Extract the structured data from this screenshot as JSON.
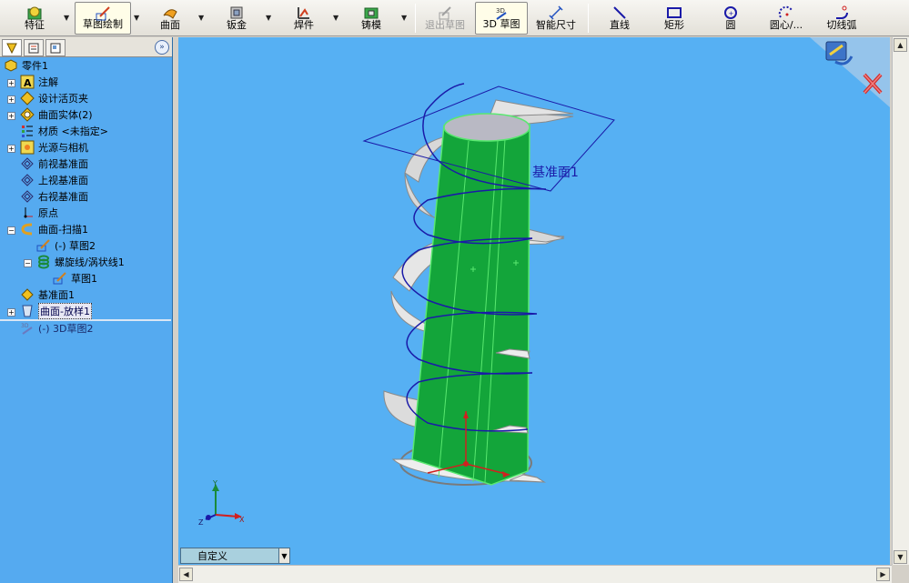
{
  "toolbar": {
    "features": "特征",
    "sketch": "草图绘制",
    "surfaces": "曲面",
    "sheet_metal": "钣金",
    "weldments": "焊件",
    "molds": "铸模",
    "exit_sketch": "退出草图",
    "sketch_3d": "3D 草图",
    "smart_dimension": "智能尺寸",
    "line": "直线",
    "rectangle": "矩形",
    "circle": "圆",
    "centerpoint_arc": "圆心/...",
    "tangent_arc": "切线弧"
  },
  "tree": {
    "items": [
      {
        "label": "零件1"
      },
      {
        "label": "注解"
      },
      {
        "label": "设计活页夹"
      },
      {
        "label": "曲面实体(2)"
      },
      {
        "label": "材质 <未指定>"
      },
      {
        "label": "光源与相机"
      },
      {
        "label": "前视基准面"
      },
      {
        "label": "上视基准面"
      },
      {
        "label": "右视基准面"
      },
      {
        "label": "原点"
      },
      {
        "label": "曲面-扫描1"
      },
      {
        "label": "(-) 草图2"
      },
      {
        "label": "螺旋线/涡状线1"
      },
      {
        "label": "草图1"
      },
      {
        "label": "基准面1"
      },
      {
        "label": "曲面-放样1"
      },
      {
        "label": "(-) 3D草图2"
      }
    ]
  },
  "viewport": {
    "plane_label": "基准面1",
    "triad": {
      "x": "X",
      "y": "Y",
      "z": "Z"
    },
    "view_orientation": "自定义"
  },
  "colors": {
    "viewport_bg": "#56b0f3",
    "tree_bg": "#55aaf0",
    "surface_green": "#13a53a",
    "helix_blue": "#1a1aa8"
  }
}
